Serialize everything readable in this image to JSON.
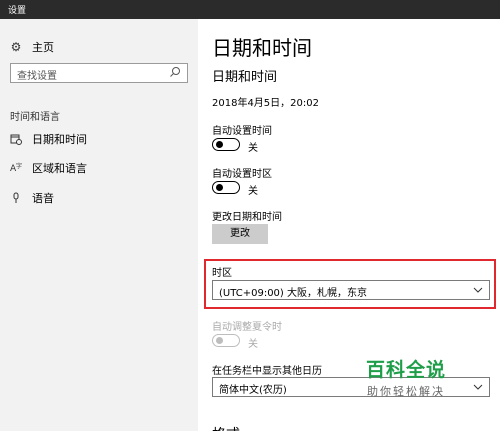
{
  "window": {
    "title": "设置"
  },
  "sidebar": {
    "home_label": "主页",
    "search_placeholder": "查找设置",
    "section_title": "时间和语言",
    "items": [
      {
        "label": "日期和时间",
        "icon": "calendar-clock-icon"
      },
      {
        "label": "区域和语言",
        "icon": "language-icon"
      },
      {
        "label": "语音",
        "icon": "microphone-icon"
      }
    ]
  },
  "content": {
    "title": "日期和时间",
    "subtitle": "日期和时间",
    "current_datetime": "2018年4月5日，20:02",
    "auto_time": {
      "label": "自动设置时间",
      "state": "关"
    },
    "auto_timezone": {
      "label": "自动设置时区",
      "state": "关"
    },
    "change_datetime": {
      "label": "更改日期和时间",
      "button": "更改"
    },
    "timezone": {
      "label": "时区",
      "value": "(UTC+09:00) 大阪，札幌，东京"
    },
    "dst": {
      "label": "自动调整夏令时",
      "state": "关"
    },
    "calendar": {
      "label": "在任务栏中显示其他日历",
      "value": "简体中文(农历)"
    },
    "bottom_partial": "格式"
  },
  "watermark": {
    "main": "百科全说",
    "sub": "助你轻松解决"
  },
  "colors": {
    "highlight_border": "#e0282e",
    "watermark_green": "#1f9e4a"
  }
}
